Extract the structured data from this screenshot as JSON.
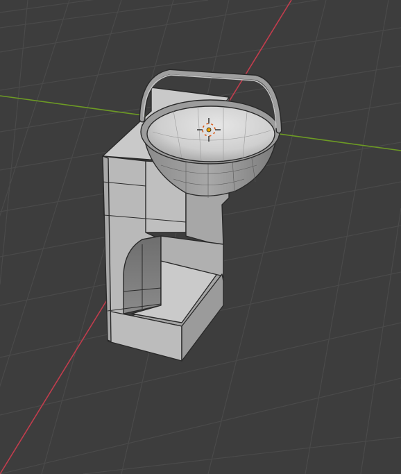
{
  "viewport": {
    "background_color": "#3d3d3d",
    "grid_color": "#4a4a4a",
    "axis_x_color": "#c13d4d",
    "axis_y_color": "#6d9b24",
    "object_light": "#cfcfcf",
    "object_mid": "#b3b3b3",
    "object_dark": "#8e8e8e",
    "object_shadow": "#6a6a6a",
    "wire_color": "#2a2a2a",
    "cursor_ring": "#e4e4e4",
    "cursor_accent": "#d85a1a",
    "icons": {
      "cursor": "3d-cursor-icon",
      "object": "sink-mesh-object"
    }
  }
}
